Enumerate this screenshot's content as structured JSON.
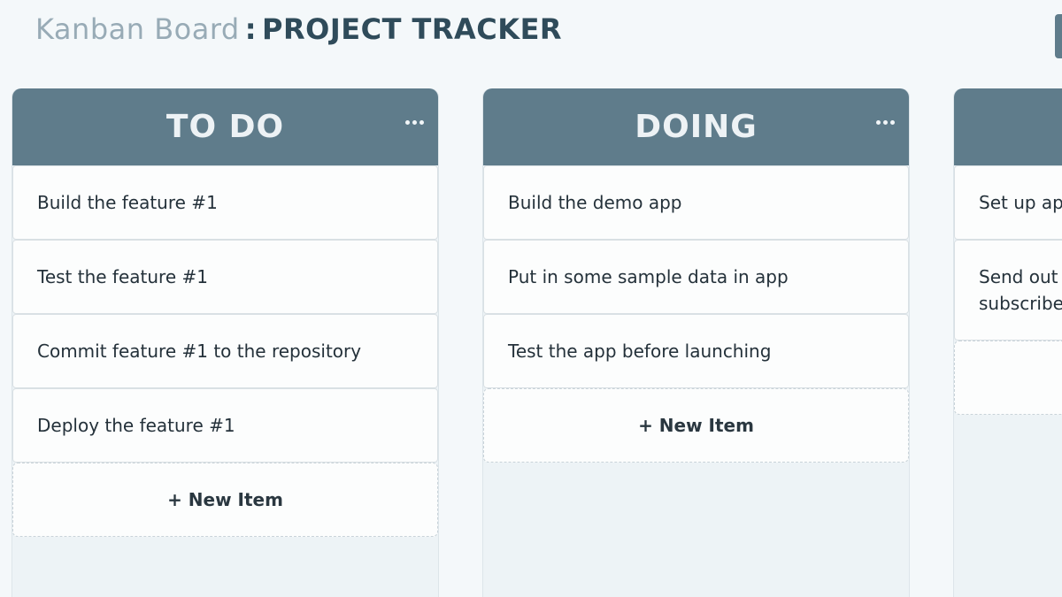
{
  "header": {
    "brand": "Kanban Board",
    "separator": ":",
    "project": "PROJECT TRACKER"
  },
  "columns": [
    {
      "title": "TO DO",
      "cards": [
        "Build the feature #1",
        "Test the feature #1",
        "Commit feature #1 to the repository",
        "Deploy the feature #1"
      ],
      "new_item_label": "+ New Item"
    },
    {
      "title": "DOING",
      "cards": [
        "Build the demo app",
        "Put in some sample data in app",
        "Test the app before launching"
      ],
      "new_item_label": "+ New Item"
    },
    {
      "title": "",
      "cards": [
        "Set up app",
        "Send out e subscribe"
      ]
    }
  ],
  "colors": {
    "column_header": "#5f7c8b",
    "column_body": "#edf3f6",
    "page_bg": "#f4f8fa",
    "brand_text": "#98abb6",
    "project_text": "#2f4b5a"
  }
}
